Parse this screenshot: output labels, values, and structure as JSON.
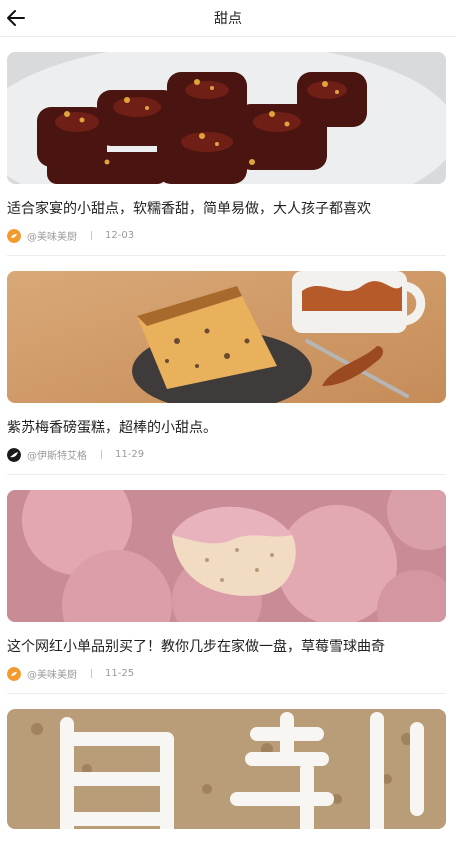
{
  "header": {
    "title": "甜点",
    "back_icon": "arrow-left-icon"
  },
  "articles": [
    {
      "headline": "适合家宴的小甜点，软糯香甜，简单易做，大人孩子都喜欢",
      "author": "@美味美厨",
      "date": "12-03"
    },
    {
      "headline": "紫苏梅香磅蛋糕，超棒的小甜点。",
      "author": "@伊斯特艾格",
      "date": "11-29"
    },
    {
      "headline": "这个网红小单品别买了！教你几步在家做一盘，草莓雪球曲奇",
      "author": "@美味美厨",
      "date": "11-25"
    }
  ]
}
